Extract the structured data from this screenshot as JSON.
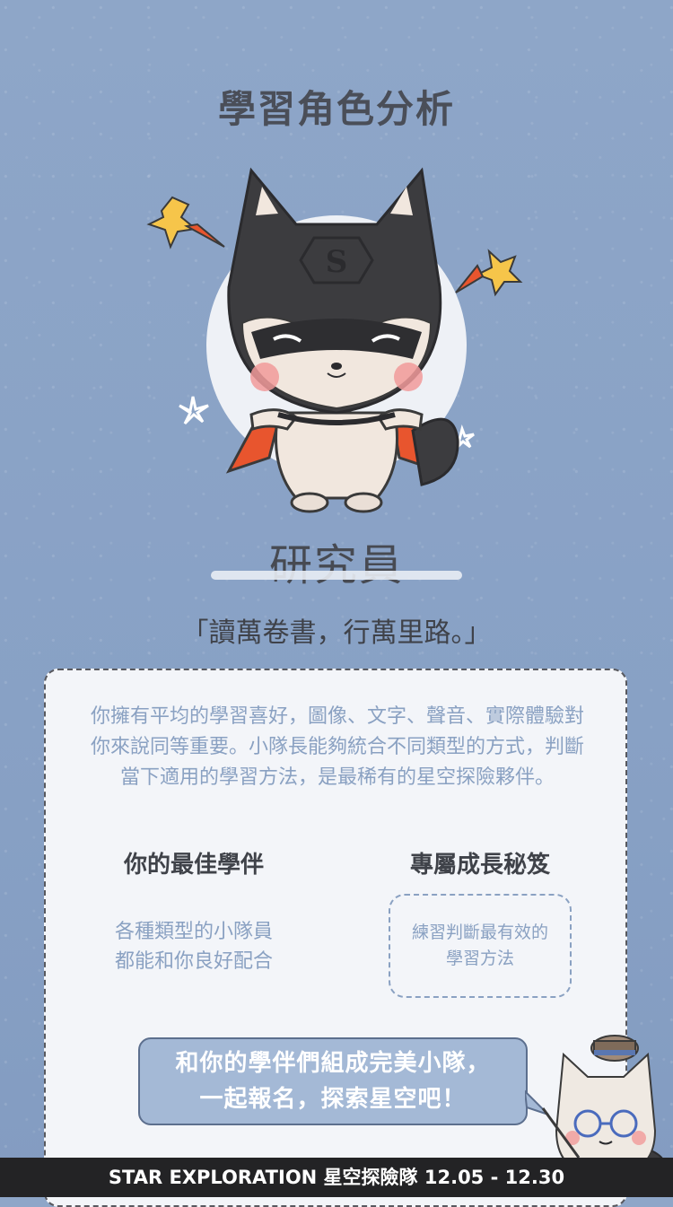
{
  "header": {
    "title": "學習角色分析"
  },
  "role": {
    "name": "研究員",
    "quote": "「讀萬卷書，行萬里路。」",
    "emblem_letter": "S"
  },
  "card": {
    "description": "你擁有平均的學習喜好，圖像、文字、聲音、實際體驗對你來說同等重要。小隊長能夠統合不同類型的方式，判斷當下適用的學習方法，是最稀有的星空探險夥伴。",
    "partner": {
      "title": "你的最佳學伴",
      "line1": "各種類型的小隊員",
      "line2": "都能和你良好配合"
    },
    "secret": {
      "title": "專屬成長秘笈",
      "line1": "練習判斷最有效的",
      "line2": "學習方法"
    }
  },
  "bubble": {
    "line1": "和你的學伴們組成完美小隊，",
    "line2": "一起報名，探索星空吧！"
  },
  "footer": {
    "text": "STAR EXPLORATION 星空探險隊 12.05 - 12.30"
  },
  "colors": {
    "background": "#8ea6c8",
    "card": "#f3f5f9",
    "accent_text": "#8aa1c2",
    "cape": "#e8552e",
    "footer": "#232325"
  },
  "icons": [
    "superhero-shiba-mascot",
    "star-icon",
    "sparkle-icon",
    "explorer-cat-mascot"
  ]
}
